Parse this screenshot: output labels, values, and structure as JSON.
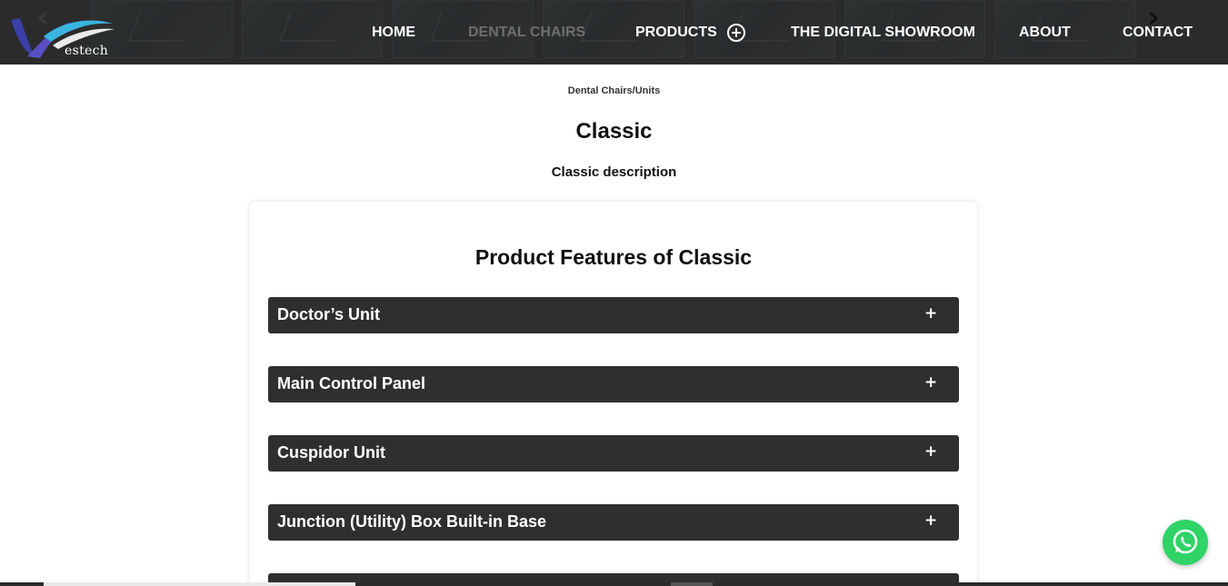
{
  "header": {
    "logo_text": "estech",
    "nav": [
      {
        "label": "HOME",
        "active": false
      },
      {
        "label": "DENTAL CHAIRS",
        "active": true
      },
      {
        "label": "PRODUCTS",
        "active": false
      },
      {
        "label": "THE DIGITAL SHOWROOM",
        "active": false
      },
      {
        "label": "ABOUT",
        "active": false
      },
      {
        "label": "CONTACT",
        "active": false
      }
    ]
  },
  "breadcrumb": "Dental Chairs/Units",
  "page_title": "Classic",
  "page_subtitle": "Classic description",
  "features": {
    "title": "Product Features of Classic",
    "items": [
      {
        "label": "Doctor’s Unit"
      },
      {
        "label": "Main Control Panel"
      },
      {
        "label": "Cuspidor Unit"
      },
      {
        "label": "Junction (Utility) Box Built-in Base"
      },
      {
        "label": ""
      }
    ],
    "expand_symbol": "+"
  },
  "colors": {
    "header_bg": "#2f2f2f",
    "accordion_bg": "#2f2f2f",
    "nav_active": "#6e6e6e",
    "whatsapp": "#2fd366"
  }
}
